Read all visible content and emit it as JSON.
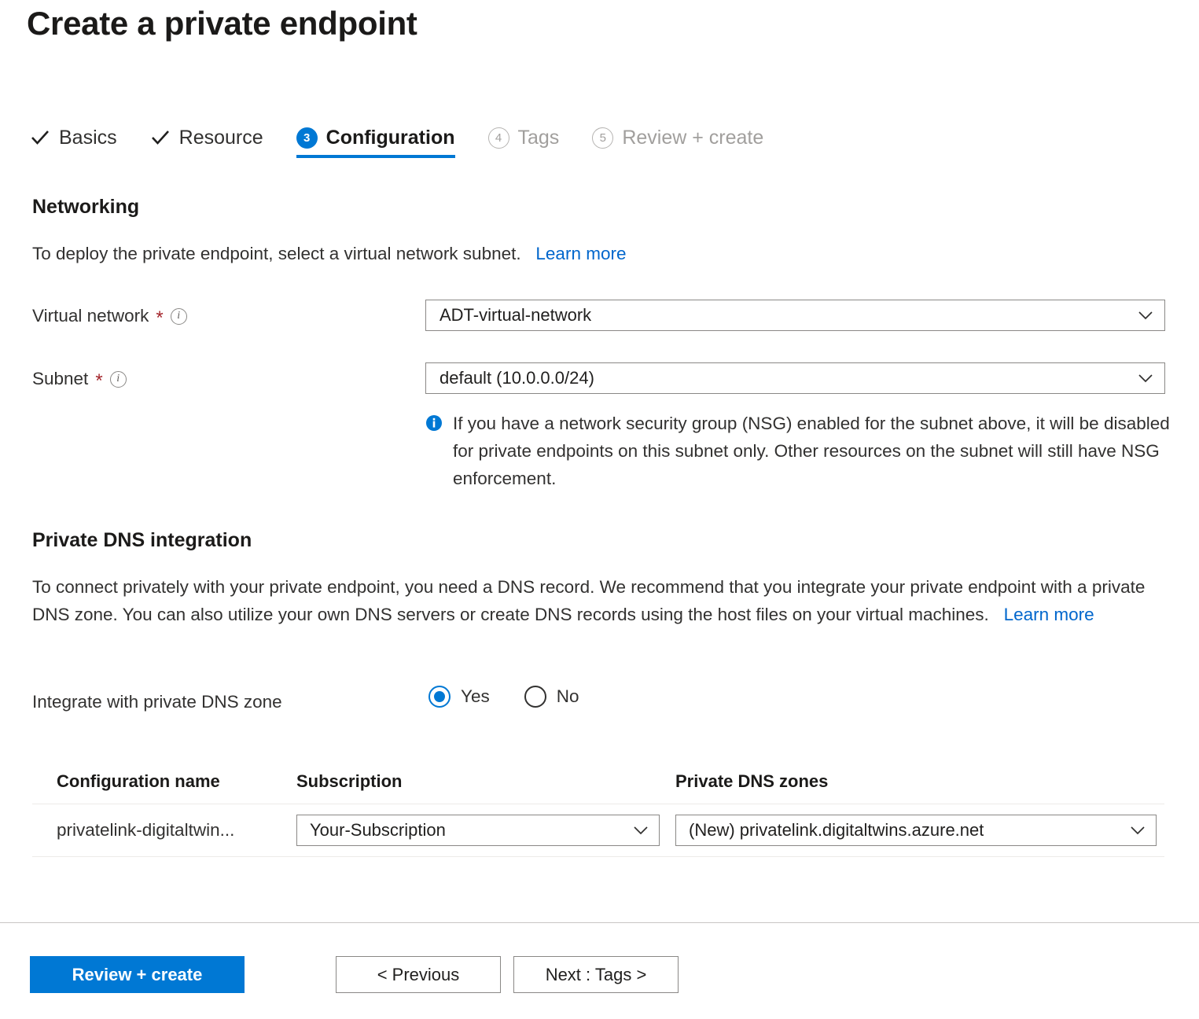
{
  "page": {
    "title": "Create a private endpoint"
  },
  "wizard": {
    "tabs": [
      {
        "label": "Basics",
        "state": "done",
        "marker": "check"
      },
      {
        "label": "Resource",
        "state": "done",
        "marker": "check"
      },
      {
        "label": "Configuration",
        "state": "active",
        "marker": "3"
      },
      {
        "label": "Tags",
        "state": "disabled",
        "marker": "4"
      },
      {
        "label": "Review + create",
        "state": "disabled",
        "marker": "5"
      }
    ]
  },
  "networking": {
    "heading": "Networking",
    "description": "To deploy the private endpoint, select a virtual network subnet.",
    "learn_more": "Learn more",
    "virtual_network": {
      "label": "Virtual network",
      "required": "*",
      "value": "ADT-virtual-network"
    },
    "subnet": {
      "label": "Subnet",
      "required": "*",
      "value": "default (10.0.0.0/24)"
    },
    "note": "If you have a network security group (NSG) enabled for the subnet above, it will be disabled for private endpoints on this subnet only. Other resources on the subnet will still have NSG enforcement."
  },
  "private_dns": {
    "heading": "Private DNS integration",
    "description": "To connect privately with your private endpoint, you need a DNS record. We recommend that you integrate your private endpoint with a private DNS zone. You can also utilize your own DNS servers or create DNS records using the host files on your virtual machines.",
    "learn_more": "Learn more",
    "integrate_label": "Integrate with private DNS zone",
    "radio": {
      "yes_label": "Yes",
      "no_label": "No",
      "selected": "Yes"
    },
    "table": {
      "headers": {
        "configuration_name": "Configuration name",
        "subscription": "Subscription",
        "private_dns_zones": "Private DNS zones"
      },
      "rows": [
        {
          "configuration_name": "privatelink-digitaltwin...",
          "subscription": "Your-Subscription",
          "private_dns_zone": "(New) privatelink.digitaltwins.azure.net"
        }
      ]
    }
  },
  "footer": {
    "review_create": "Review + create",
    "previous": "< Previous",
    "next": "Next : Tags >"
  },
  "colors": {
    "accent": "#0078d4",
    "link": "#0066cc",
    "required": "#a4262c",
    "text": "#323130",
    "border": "#8a8886",
    "divider": "#edebe9"
  }
}
